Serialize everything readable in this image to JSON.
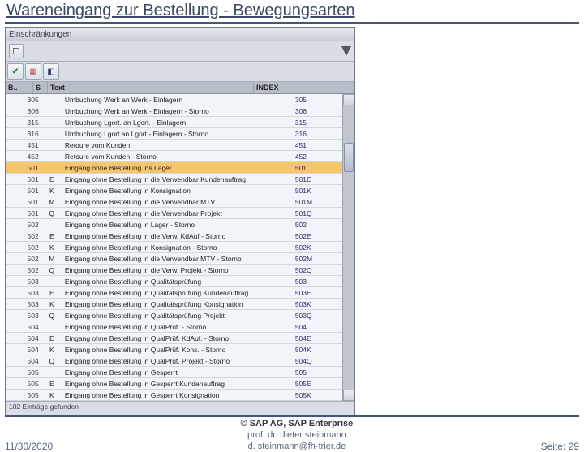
{
  "title": "Wareneingang zur Bestellung - Bewegungsarten",
  "window": {
    "title": "Einschränkungen"
  },
  "columns": {
    "code": "B..",
    "flag": "S",
    "text": "Text",
    "index": "INDEX"
  },
  "rows": [
    {
      "c": "305",
      "f": "",
      "t": "Umbuchung Werk an Werk - Einlagern",
      "i": "305",
      "sel": false
    },
    {
      "c": "306",
      "f": "",
      "t": "Umbuchung Werk an Werk - Einlagern - Storno",
      "i": "306",
      "sel": false
    },
    {
      "c": "315",
      "f": "",
      "t": "Umbuchung Lgort. an Lgort. - Einlagern",
      "i": "315",
      "sel": false
    },
    {
      "c": "316",
      "f": "",
      "t": "Umbuchung Lgort an Lgort - Einlagern - Storno",
      "i": "316",
      "sel": false
    },
    {
      "c": "451",
      "f": "",
      "t": "Retoure vom Kunden",
      "i": "451",
      "sel": false
    },
    {
      "c": "452",
      "f": "",
      "t": "Retoure vom Kunden - Storno",
      "i": "452",
      "sel": false
    },
    {
      "c": "501",
      "f": "",
      "t": "Eingang ohne Bestellung ins Lager",
      "i": "501",
      "sel": true
    },
    {
      "c": "501",
      "f": "E",
      "t": "Eingang ohne Bestellung in die Verwendbar Kundenauftrag",
      "i": "501E",
      "sel": false
    },
    {
      "c": "501",
      "f": "K",
      "t": "Eingang ohne Bestellung in Konsignation",
      "i": "501K",
      "sel": false
    },
    {
      "c": "501",
      "f": "M",
      "t": "Eingang ohne Bestellung in die Verwendbar MTV",
      "i": "501M",
      "sel": false
    },
    {
      "c": "501",
      "f": "Q",
      "t": "Eingang ohne Bestellung in die Verwendbar Projekt",
      "i": "501Q",
      "sel": false
    },
    {
      "c": "502",
      "f": "",
      "t": "Eingang ohne Bestellung in Lager - Storno",
      "i": "502",
      "sel": false
    },
    {
      "c": "502",
      "f": "E",
      "t": "Eingang ohne Bestellung in die Verw. KdAuf - Storno",
      "i": "502E",
      "sel": false
    },
    {
      "c": "502",
      "f": "K",
      "t": "Eingang ohne Bestellung in Konsignation - Storno",
      "i": "502K",
      "sel": false
    },
    {
      "c": "502",
      "f": "M",
      "t": "Eingang ohne Bestellung in die Verwendbar MTV - Storno",
      "i": "502M",
      "sel": false
    },
    {
      "c": "502",
      "f": "Q",
      "t": "Eingang ohne Bestellung in die Verw. Projekt - Storno",
      "i": "502Q",
      "sel": false
    },
    {
      "c": "503",
      "f": "",
      "t": "Eingang ohne Bestellung in Qualitätsprüfung",
      "i": "503",
      "sel": false
    },
    {
      "c": "503",
      "f": "E",
      "t": "Eingang ohne Bestellung in Qualitätsprüfung Kundenauftrag",
      "i": "503E",
      "sel": false
    },
    {
      "c": "503",
      "f": "K",
      "t": "Eingang ohne Bestellung in Qualitätsprüfung Konsignation",
      "i": "503K",
      "sel": false
    },
    {
      "c": "503",
      "f": "Q",
      "t": "Eingang ohne Bestellung in Qualitätsprüfung Projekt",
      "i": "503Q",
      "sel": false
    },
    {
      "c": "504",
      "f": "",
      "t": "Eingang ohne Bestellung in QualPrüf. - Storno",
      "i": "504",
      "sel": false
    },
    {
      "c": "504",
      "f": "E",
      "t": "Eingang ohne Bestellung in QualPrüf. KdAuf. - Storno",
      "i": "504E",
      "sel": false
    },
    {
      "c": "504",
      "f": "K",
      "t": "Eingang ohne Bestellung in QualPrüf. Kons. - Storno",
      "i": "504K",
      "sel": false
    },
    {
      "c": "504",
      "f": "Q",
      "t": "Eingang ohne Bestellung in QualPrüf. Projekt - Storno",
      "i": "504Q",
      "sel": false
    },
    {
      "c": "505",
      "f": "",
      "t": "Eingang ohne Bestellung in Gesperrt",
      "i": "505",
      "sel": false
    },
    {
      "c": "505",
      "f": "E",
      "t": "Eingang ohne Bestellung in Gesperrt Kundenauftrag",
      "i": "505E",
      "sel": false
    },
    {
      "c": "505",
      "f": "K",
      "t": "Eingang ohne Bestellung in Gesperrt Konsignation",
      "i": "505K",
      "sel": false
    }
  ],
  "status": "102 Einträge gefunden",
  "footer": {
    "date": "11/30/2020",
    "copyright": "© SAP AG, SAP Enterprise",
    "author": "prof. dr. dieter steinmann",
    "email": "d. steinmann@fh-trier.de",
    "page": "Seite: 29"
  }
}
